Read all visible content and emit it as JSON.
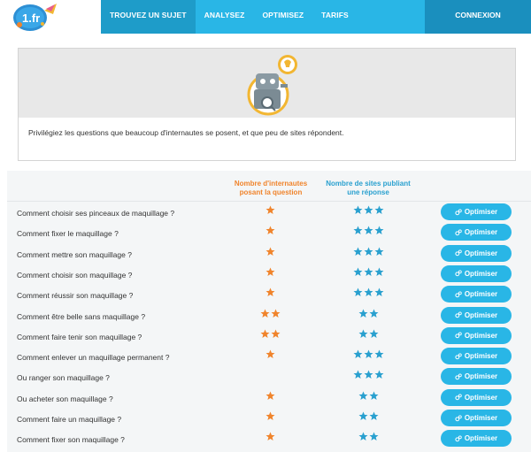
{
  "nav": {
    "items": [
      {
        "label": "TROUVEZ UN SUJET",
        "active": true
      },
      {
        "label": "ANALYSEZ",
        "active": false
      },
      {
        "label": "OPTIMISEZ",
        "active": false
      },
      {
        "label": "TARIFS",
        "active": false
      }
    ],
    "login_label": "CONNEXION",
    "logo_text": "1.fr"
  },
  "info": {
    "text": "Privilégiez les questions que beaucoup d'internautes se posent, et que peu de sites répondent."
  },
  "table": {
    "header_internautes": "Nombre d'internautes posant la question",
    "header_sites": "Nombre de sites publiant une réponse",
    "button_label": "Optimiser",
    "rows": [
      {
        "question": "Comment choisir ses pinceaux de maquillage ?",
        "internautes": 1,
        "sites": 3
      },
      {
        "question": "Comment fixer le maquillage ?",
        "internautes": 1,
        "sites": 3
      },
      {
        "question": "Comment mettre son maquillage ?",
        "internautes": 1,
        "sites": 3
      },
      {
        "question": "Comment choisir son maquillage ?",
        "internautes": 1,
        "sites": 3
      },
      {
        "question": "Comment réussir son maquillage ?",
        "internautes": 1,
        "sites": 3
      },
      {
        "question": "Comment être belle sans maquillage ?",
        "internautes": 2,
        "sites": 2
      },
      {
        "question": "Comment faire tenir son maquillage ?",
        "internautes": 2,
        "sites": 2
      },
      {
        "question": "Comment enlever un maquillage permanent ?",
        "internautes": 1,
        "sites": 3
      },
      {
        "question": "Ou ranger son maquillage ?",
        "internautes": 0,
        "sites": 3
      },
      {
        "question": "Ou acheter son maquillage ?",
        "internautes": 1,
        "sites": 2
      },
      {
        "question": "Comment faire un maquillage ?",
        "internautes": 1,
        "sites": 2
      },
      {
        "question": "Comment fixer son maquillage ?",
        "internautes": 1,
        "sites": 2
      }
    ]
  },
  "colors": {
    "nav_blue": "#29b6e6",
    "nav_active": "#1e9cc9",
    "login_bg": "#1a8fbe",
    "star_orange": "#f0842c",
    "star_blue": "#29a0cf"
  }
}
